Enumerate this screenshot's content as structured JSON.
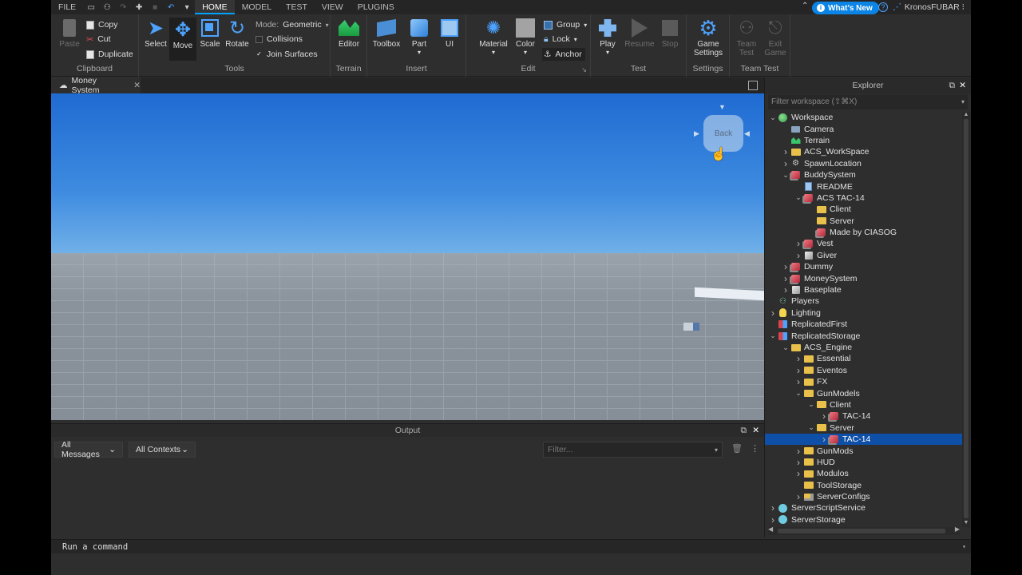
{
  "menu": {
    "file": "FILE",
    "tabs": [
      "HOME",
      "MODEL",
      "TEST",
      "VIEW",
      "PLUGINS"
    ],
    "whats_new": "What's New",
    "username": "KronosFUBAR"
  },
  "ribbon": {
    "clipboard": {
      "label": "Clipboard",
      "paste": "Paste",
      "copy": "Copy",
      "cut": "Cut",
      "duplicate": "Duplicate"
    },
    "tools": {
      "label": "Tools",
      "select": "Select",
      "move": "Move",
      "scale": "Scale",
      "rotate": "Rotate",
      "mode_label": "Mode:",
      "mode_value": "Geometric",
      "collisions": "Collisions",
      "join_surfaces": "Join Surfaces"
    },
    "terrain": {
      "label": "Terrain",
      "editor": "Editor"
    },
    "insert": {
      "label": "Insert",
      "toolbox": "Toolbox",
      "part": "Part",
      "ui": "UI"
    },
    "edit": {
      "label": "Edit",
      "material": "Material",
      "color": "Color",
      "group": "Group",
      "lock": "Lock",
      "anchor": "Anchor"
    },
    "test": {
      "label": "Test",
      "play": "Play",
      "resume": "Resume",
      "stop": "Stop"
    },
    "settings": {
      "label": "Settings",
      "game_settings_1": "Game",
      "game_settings_2": "Settings"
    },
    "team_test": {
      "label": "Team Test",
      "team_1": "Team",
      "team_2": "Test",
      "exit_1": "Exit",
      "exit_2": "Game"
    }
  },
  "document_tab": "Money System",
  "viewcube_label": "Back",
  "output": {
    "title": "Output",
    "messages_filter": "All Messages",
    "contexts_filter": "All Contexts",
    "filter_placeholder": "Filter..."
  },
  "command_bar_placeholder": "Run a command",
  "explorer": {
    "title": "Explorer",
    "filter_placeholder": "Filter workspace (⇧⌘X)",
    "items": [
      {
        "label": "Workspace",
        "depth": 0,
        "arrow": "open",
        "icon": "globe-icon"
      },
      {
        "label": "Camera",
        "depth": 1,
        "arrow": "",
        "icon": "camera-icon"
      },
      {
        "label": "Terrain",
        "depth": 1,
        "arrow": "",
        "icon": "terrain-icon"
      },
      {
        "label": "ACS_WorkSpace",
        "depth": 1,
        "arrow": "closed",
        "icon": "folder-icon"
      },
      {
        "label": "SpawnLocation",
        "depth": 1,
        "arrow": "closed",
        "icon": "spawn-icon"
      },
      {
        "label": "BuddySystem",
        "depth": 1,
        "arrow": "open",
        "icon": "model-icon"
      },
      {
        "label": "README",
        "depth": 2,
        "arrow": "",
        "icon": "script-icon"
      },
      {
        "label": "ACS TAC-14",
        "depth": 2,
        "arrow": "open",
        "icon": "model-icon"
      },
      {
        "label": "Client",
        "depth": 3,
        "arrow": "",
        "icon": "folder-icon"
      },
      {
        "label": "Server",
        "depth": 3,
        "arrow": "",
        "icon": "folder-icon"
      },
      {
        "label": "Made by CIASOG",
        "depth": 3,
        "arrow": "",
        "icon": "model-icon"
      },
      {
        "label": "Vest",
        "depth": 2,
        "arrow": "closed",
        "icon": "model-icon"
      },
      {
        "label": "Giver",
        "depth": 2,
        "arrow": "closed",
        "icon": "part-icon"
      },
      {
        "label": "Dummy",
        "depth": 1,
        "arrow": "closed",
        "icon": "model-icon"
      },
      {
        "label": "MoneySystem",
        "depth": 1,
        "arrow": "closed",
        "icon": "model-icon"
      },
      {
        "label": "Baseplate",
        "depth": 1,
        "arrow": "closed",
        "icon": "part-icon"
      },
      {
        "label": "Players",
        "depth": 0,
        "arrow": "",
        "icon": "players-icon"
      },
      {
        "label": "Lighting",
        "depth": 0,
        "arrow": "closed",
        "icon": "bulb-icon"
      },
      {
        "label": "ReplicatedFirst",
        "depth": 0,
        "arrow": "",
        "icon": "replicated-icon"
      },
      {
        "label": "ReplicatedStorage",
        "depth": 0,
        "arrow": "open",
        "icon": "replicated-icon"
      },
      {
        "label": "ACS_Engine",
        "depth": 1,
        "arrow": "open",
        "icon": "folder-icon"
      },
      {
        "label": "Essential",
        "depth": 2,
        "arrow": "closed",
        "icon": "folder-icon"
      },
      {
        "label": "Eventos",
        "depth": 2,
        "arrow": "closed",
        "icon": "folder-icon"
      },
      {
        "label": "FX",
        "depth": 2,
        "arrow": "closed",
        "icon": "folder-icon"
      },
      {
        "label": "GunModels",
        "depth": 2,
        "arrow": "open",
        "icon": "folder-icon"
      },
      {
        "label": "Client",
        "depth": 3,
        "arrow": "open",
        "icon": "folder-icon"
      },
      {
        "label": "TAC-14",
        "depth": 4,
        "arrow": "closed",
        "icon": "model-icon"
      },
      {
        "label": "Server",
        "depth": 3,
        "arrow": "open",
        "icon": "folder-icon"
      },
      {
        "label": "TAC-14",
        "depth": 4,
        "arrow": "closed",
        "icon": "model-icon",
        "selected": true
      },
      {
        "label": "GunMods",
        "depth": 2,
        "arrow": "closed",
        "icon": "folder-icon"
      },
      {
        "label": "HUD",
        "depth": 2,
        "arrow": "closed",
        "icon": "folder-icon"
      },
      {
        "label": "Modulos",
        "depth": 2,
        "arrow": "closed",
        "icon": "folder-icon"
      },
      {
        "label": "ToolStorage",
        "depth": 2,
        "arrow": "",
        "icon": "folder-icon"
      },
      {
        "label": "ServerConfigs",
        "depth": 2,
        "arrow": "closed",
        "icon": "config-icon"
      },
      {
        "label": "ServerScriptService",
        "depth": 0,
        "arrow": "closed",
        "icon": "server-icon"
      },
      {
        "label": "ServerStorage",
        "depth": 0,
        "arrow": "closed",
        "icon": "server-icon"
      }
    ]
  },
  "colors": {
    "accent": "#00a2ff",
    "selection": "#0e4fa8",
    "folder": "#e8c04a",
    "model": "#d9454f"
  }
}
